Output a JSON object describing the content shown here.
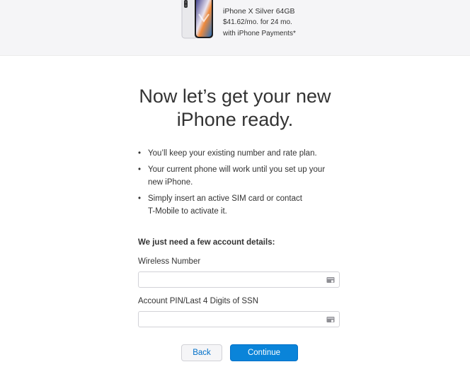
{
  "product": {
    "name": "iPhone X Silver 64GB",
    "price_line": "$41.62/mo. for 24 mo.",
    "plan_line": "with iPhone Payments*"
  },
  "headline": {
    "line1": "Now let’s get your new",
    "line2": "iPhone ready."
  },
  "bullets": [
    {
      "line1": "You’ll keep your existing number and rate plan.",
      "line2": ""
    },
    {
      "line1": "Your current phone will work until you set up your",
      "line2": "new iPhone."
    },
    {
      "line1": "Simply insert an active SIM card or contact",
      "line2": "T-Mobile to activate it."
    }
  ],
  "form": {
    "section_title": "We just need a few account details:",
    "fields": [
      {
        "label": "Wireless Number",
        "value": "",
        "icon": "keychain-icon"
      },
      {
        "label": "Account PIN/Last 4 Digits of SSN",
        "value": "",
        "icon": "keychain-icon"
      }
    ]
  },
  "buttons": {
    "back": "Back",
    "continue": "Continue"
  },
  "colors": {
    "accent": "#0a84d9",
    "link": "#0070c9",
    "topbar_bg": "#f5f5f7"
  }
}
